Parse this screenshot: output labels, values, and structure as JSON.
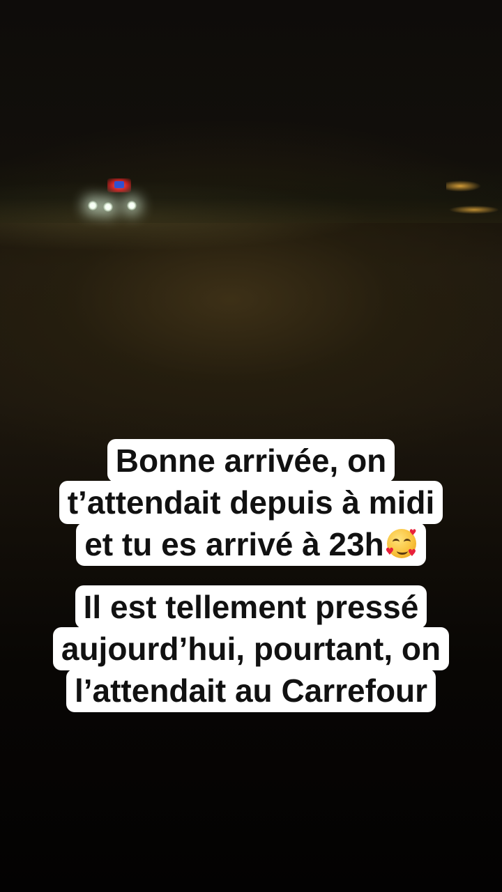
{
  "caption_1": {
    "line_1": "Bonne arrivée, on",
    "line_2": "t’attendait depuis à midi",
    "line_3": "et tu es arrivé à 23h",
    "emoji": "smiling-face-with-hearts-icon"
  },
  "caption_2": {
    "line_1": "Il est tellement pressé",
    "line_2": "aujourd’hui, pourtant, on",
    "line_3": "l’attendait au Carrefour"
  },
  "colors": {
    "caption_background": "#ffffff",
    "caption_text": "#111111",
    "scene_background": "#000000"
  }
}
